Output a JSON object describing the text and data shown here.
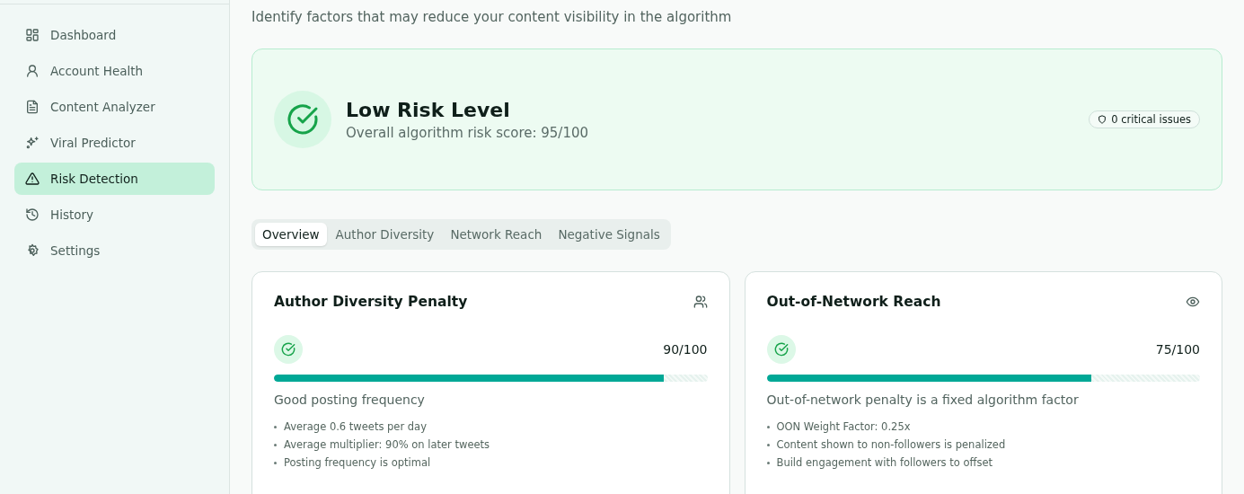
{
  "sidebar": {
    "items": [
      {
        "label": "Dashboard",
        "selected": false
      },
      {
        "label": "Account Health",
        "selected": false
      },
      {
        "label": "Content Analyzer",
        "selected": false
      },
      {
        "label": "Viral Predictor",
        "selected": false
      },
      {
        "label": "Risk Detection",
        "selected": true
      },
      {
        "label": "History",
        "selected": false
      },
      {
        "label": "Settings",
        "selected": false
      }
    ]
  },
  "subtitle": "Identify factors that may reduce your content visibility in the algorithm",
  "summary": {
    "title": "Low Risk Level",
    "score": "Overall algorithm risk score: 95/100",
    "badge": "0 critical issues"
  },
  "tabs": [
    {
      "label": "Overview",
      "selected": true
    },
    {
      "label": "Author Diversity",
      "selected": false
    },
    {
      "label": "Network Reach",
      "selected": false
    },
    {
      "label": "Negative Signals",
      "selected": false
    }
  ],
  "cards": [
    {
      "title": "Author Diversity Penalty",
      "score": "90/100",
      "level": 0.9,
      "status": "Good posting frequency",
      "points": [
        "Average 0.6 tweets per day",
        "Average multiplier: 90% on later tweets",
        "Posting frequency is optimal"
      ]
    },
    {
      "title": "Out-of-Network Reach",
      "score": "75/100",
      "level": 0.75,
      "status": "Out-of-network penalty is a fixed algorithm factor",
      "points": [
        "OON Weight Factor: 0.25x",
        "Content shown to non-followers is penalized",
        "Build engagement with followers to offset"
      ]
    }
  ]
}
